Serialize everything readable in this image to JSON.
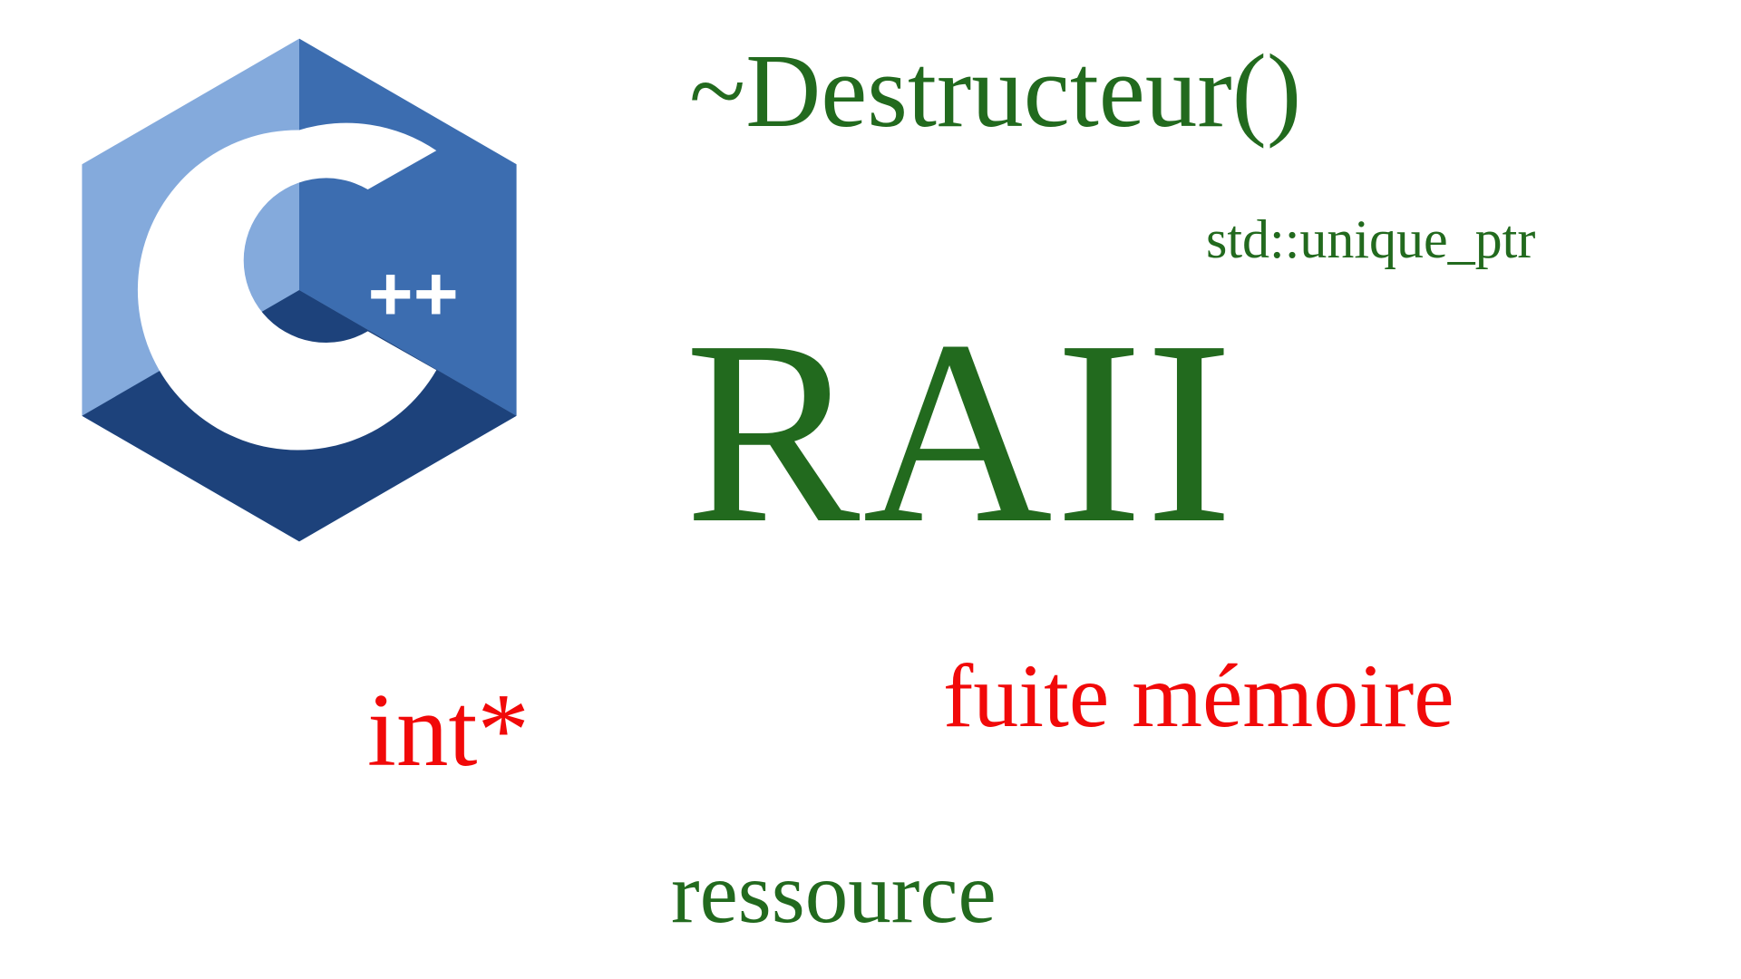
{
  "colors": {
    "green": "#226a1e",
    "red": "#f10909",
    "logo_light": "#84aadc",
    "logo_mid": "#3c6db0",
    "logo_dark": "#1d427b"
  },
  "logo": {
    "name": "cpp-logo",
    "plusplus": "++"
  },
  "texts": {
    "destructor": "~Destructeur()",
    "unique_ptr": "std::unique_ptr",
    "raii": "RAII",
    "int_ptr": "int*",
    "fuite": "fuite mémoire",
    "ressource": "ressource"
  }
}
